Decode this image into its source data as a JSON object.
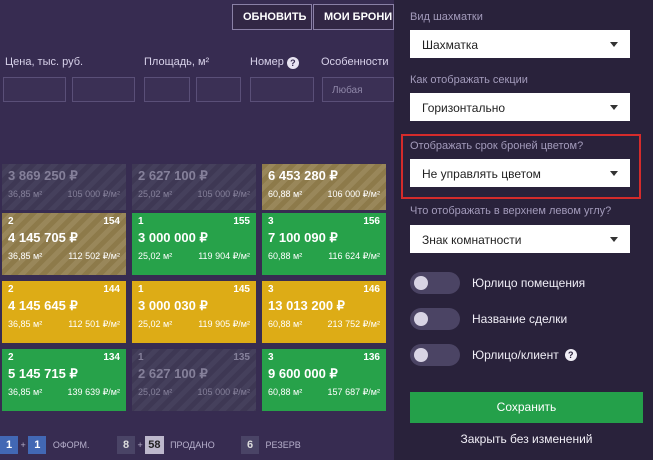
{
  "toolbar": {
    "refresh_label": "ОБНОВИТЬ",
    "my_bookings_label": "МОИ БРОНИ"
  },
  "filters": {
    "price_label": "Цена, тыс. руб.",
    "area_label": "Площадь, м²",
    "number_label": "Номер",
    "features_label": "Особенности",
    "features_placeholder": "Любая"
  },
  "grid": {
    "rows": [
      [
        {
          "status": "gray",
          "rooms": "",
          "num": "",
          "price": "3 869 250 ₽",
          "area": "36,85 м²",
          "ppm": "105 000 ₽/м²"
        },
        {
          "status": "gray",
          "rooms": "",
          "num": "",
          "price": "2 627 100 ₽",
          "area": "25,02 м²",
          "ppm": "105 000 ₽/м²"
        },
        {
          "status": "olive",
          "rooms": "",
          "num": "",
          "price": "6 453 280 ₽",
          "area": "60,88 м²",
          "ppm": "106 000 ₽/м²"
        }
      ],
      [
        {
          "status": "olive",
          "rooms": "2",
          "num": "154",
          "price": "4 145 705 ₽",
          "area": "36,85 м²",
          "ppm": "112 502 ₽/м²"
        },
        {
          "status": "green",
          "rooms": "1",
          "num": "155",
          "price": "3 000 000 ₽",
          "area": "25,02 м²",
          "ppm": "119 904 ₽/м²"
        },
        {
          "status": "green",
          "rooms": "3",
          "num": "156",
          "price": "7 100 090 ₽",
          "area": "60,88 м²",
          "ppm": "116 624 ₽/м²"
        }
      ],
      [
        {
          "status": "yellow",
          "rooms": "2",
          "num": "144",
          "price": "4 145 645 ₽",
          "area": "36,85 м²",
          "ppm": "112 501 ₽/м²"
        },
        {
          "status": "yellow",
          "rooms": "1",
          "num": "145",
          "price": "3 000 030 ₽",
          "area": "25,02 м²",
          "ppm": "119 905 ₽/м²"
        },
        {
          "status": "yellow",
          "rooms": "3",
          "num": "146",
          "price": "13 013 200 ₽",
          "area": "60,88 м²",
          "ppm": "213 752 ₽/м²"
        }
      ],
      [
        {
          "status": "green",
          "rooms": "2",
          "num": "134",
          "price": "5 145 715 ₽",
          "area": "36,85 м²",
          "ppm": "139 639 ₽/м²"
        },
        {
          "status": "gray",
          "rooms": "1",
          "num": "135",
          "price": "2 627 100 ₽",
          "area": "25,02 м²",
          "ppm": "105 000 ₽/м²"
        },
        {
          "status": "green",
          "rooms": "3",
          "num": "136",
          "price": "9 600 000 ₽",
          "area": "60,88 м²",
          "ppm": "157 687 ₽/м²"
        }
      ]
    ]
  },
  "legend": {
    "booked_a": "1",
    "plus1": "+",
    "booked_b": "1",
    "booked_label": "ОФОРМ.",
    "sold_a": "8",
    "plus2": "+",
    "sold_b": "58",
    "sold_label": "ПРОДАНО",
    "reserve_count": "6",
    "reserve_label": "РЕЗЕРВ"
  },
  "panel": {
    "view_label": "Вид шахматки",
    "view_value": "Шахматка",
    "sections_label": "Как отображать секции",
    "sections_value": "Горизонтально",
    "booking_label": "Отображать срок броней цветом?",
    "booking_value": "Не управлять цветом",
    "corner_label": "Что отображать в верхнем левом углу?",
    "corner_value": "Знак комнатности",
    "toggles": [
      "Юрлицо помещения",
      "Название сделки",
      "Юрлицо/клиент"
    ],
    "save_label": "Сохранить",
    "close_label": "Закрыть без изменений"
  },
  "colors": {
    "green": "#27a24a",
    "yellow": "#ddac16",
    "highlight": "#d52b2b",
    "panel_bg": "#29223b"
  }
}
